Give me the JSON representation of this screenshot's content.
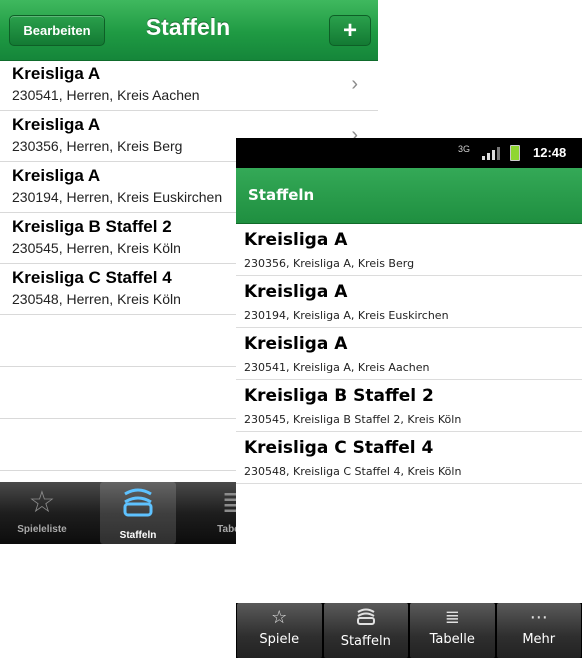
{
  "ios": {
    "navbar": {
      "edit_label": "Bearbeiten",
      "title": "Staffeln",
      "add_label": "+"
    },
    "rows": [
      {
        "title": "Kreisliga A",
        "subtitle": "230541, Herren, Kreis Aachen"
      },
      {
        "title": "Kreisliga A",
        "subtitle": "230356, Herren, Kreis Berg"
      },
      {
        "title": "Kreisliga A",
        "subtitle": "230194, Herren, Kreis Euskirchen"
      },
      {
        "title": "Kreisliga B Staffel 2",
        "subtitle": "230545, Herren, Kreis Köln"
      },
      {
        "title": "Kreisliga C Staffel 4",
        "subtitle": "230548, Herren, Kreis Köln"
      }
    ],
    "chevron": "›",
    "tabs": [
      {
        "label": "Spieleliste",
        "icon": "star-icon"
      },
      {
        "label": "Staffeln",
        "icon": "staffeln-icon"
      },
      {
        "label": "Tabelle",
        "icon": "list-icon"
      }
    ]
  },
  "android": {
    "status": {
      "network": "3G",
      "time": "12:48"
    },
    "title": "Staffeln",
    "rows": [
      {
        "title": "Kreisliga A",
        "subtitle": "230356, Kreisliga A, Kreis Berg"
      },
      {
        "title": "Kreisliga A",
        "subtitle": "230194, Kreisliga A, Kreis Euskirchen"
      },
      {
        "title": "Kreisliga A",
        "subtitle": "230541, Kreisliga A, Kreis Aachen"
      },
      {
        "title": "Kreisliga B Staffel 2",
        "subtitle": "230545, Kreisliga B Staffel 2, Kreis Köln"
      },
      {
        "title": "Kreisliga C Staffel 4",
        "subtitle": "230548, Kreisliga C Staffel 4, Kreis Köln"
      }
    ],
    "tabs": [
      {
        "label": "Spiele",
        "icon": "star-icon"
      },
      {
        "label": "Staffeln",
        "icon": "staffeln-icon"
      },
      {
        "label": "Tabelle",
        "icon": "list-icon"
      },
      {
        "label": "Mehr",
        "icon": "more-icon"
      }
    ]
  },
  "colors": {
    "brand_green": "#1f9a43",
    "active_tab_icon": "#5ec2ff"
  }
}
